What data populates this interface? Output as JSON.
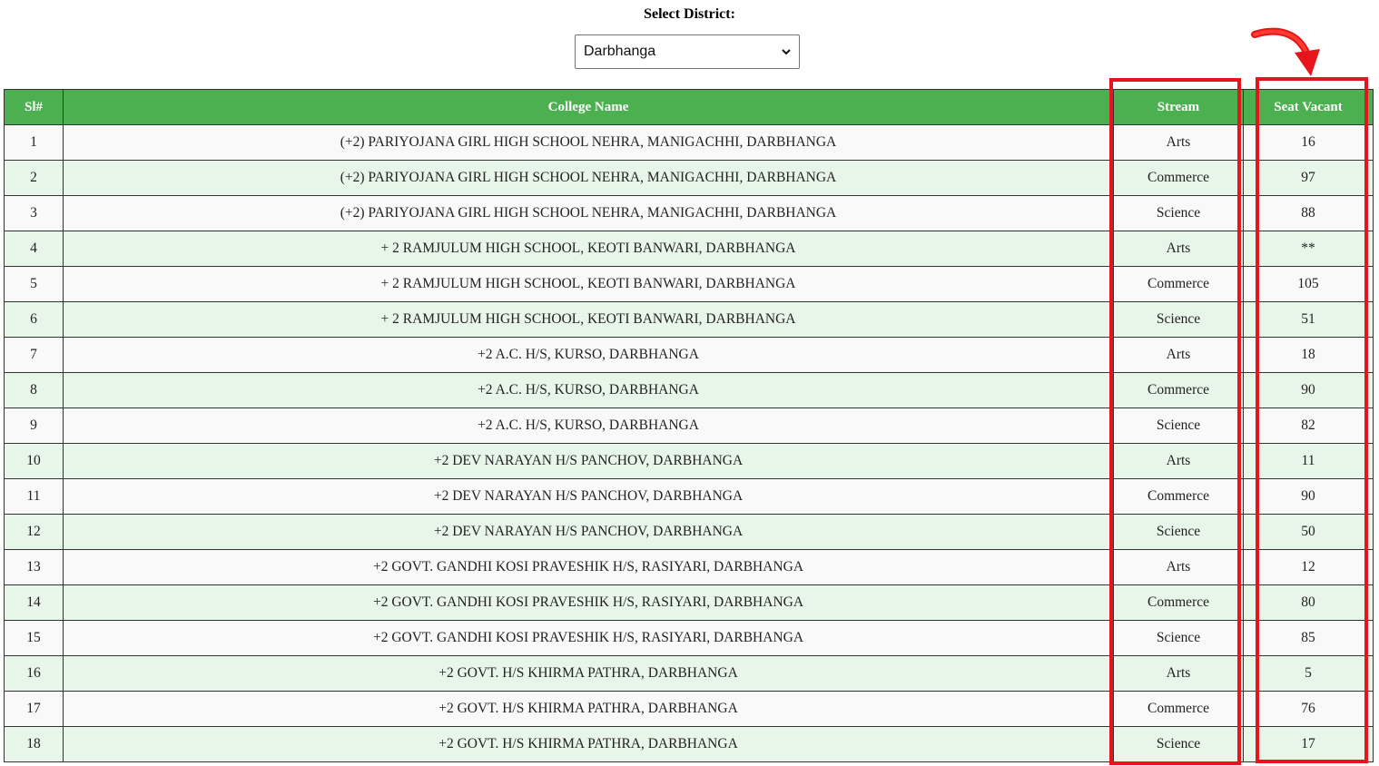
{
  "filter": {
    "label": "Select District:",
    "selected": "Darbhanga"
  },
  "table": {
    "headers": {
      "sl": "Sl#",
      "college": "College Name",
      "stream": "Stream",
      "seats": "Seat Vacant"
    },
    "rows": [
      {
        "sl": "1",
        "college": "(+2) PARIYOJANA GIRL HIGH SCHOOL NEHRA, MANIGACHHI, DARBHANGA",
        "stream": "Arts",
        "seats": "16"
      },
      {
        "sl": "2",
        "college": "(+2) PARIYOJANA GIRL HIGH SCHOOL NEHRA, MANIGACHHI, DARBHANGA",
        "stream": "Commerce",
        "seats": "97"
      },
      {
        "sl": "3",
        "college": "(+2) PARIYOJANA GIRL HIGH SCHOOL NEHRA, MANIGACHHI, DARBHANGA",
        "stream": "Science",
        "seats": "88"
      },
      {
        "sl": "4",
        "college": "+ 2 RAMJULUM HIGH SCHOOL, KEOTI BANWARI, DARBHANGA",
        "stream": "Arts",
        "seats": "**"
      },
      {
        "sl": "5",
        "college": "+ 2 RAMJULUM HIGH SCHOOL, KEOTI BANWARI, DARBHANGA",
        "stream": "Commerce",
        "seats": "105"
      },
      {
        "sl": "6",
        "college": "+ 2 RAMJULUM HIGH SCHOOL, KEOTI BANWARI, DARBHANGA",
        "stream": "Science",
        "seats": "51"
      },
      {
        "sl": "7",
        "college": "+2 A.C. H/S, KURSO, DARBHANGA",
        "stream": "Arts",
        "seats": "18"
      },
      {
        "sl": "8",
        "college": "+2 A.C. H/S, KURSO, DARBHANGA",
        "stream": "Commerce",
        "seats": "90"
      },
      {
        "sl": "9",
        "college": "+2 A.C. H/S, KURSO, DARBHANGA",
        "stream": "Science",
        "seats": "82"
      },
      {
        "sl": "10",
        "college": "+2 DEV NARAYAN H/S PANCHOV, DARBHANGA",
        "stream": "Arts",
        "seats": "11"
      },
      {
        "sl": "11",
        "college": "+2 DEV NARAYAN H/S PANCHOV, DARBHANGA",
        "stream": "Commerce",
        "seats": "90"
      },
      {
        "sl": "12",
        "college": "+2 DEV NARAYAN H/S PANCHOV, DARBHANGA",
        "stream": "Science",
        "seats": "50"
      },
      {
        "sl": "13",
        "college": "+2 GOVT. GANDHI KOSI PRAVESHIK H/S, RASIYARI, DARBHANGA",
        "stream": "Arts",
        "seats": "12"
      },
      {
        "sl": "14",
        "college": "+2 GOVT. GANDHI KOSI PRAVESHIK H/S, RASIYARI, DARBHANGA",
        "stream": "Commerce",
        "seats": "80"
      },
      {
        "sl": "15",
        "college": "+2 GOVT. GANDHI KOSI PRAVESHIK H/S, RASIYARI, DARBHANGA",
        "stream": "Science",
        "seats": "85"
      },
      {
        "sl": "16",
        "college": "+2 GOVT. H/S KHIRMA PATHRA, DARBHANGA",
        "stream": "Arts",
        "seats": "5"
      },
      {
        "sl": "17",
        "college": "+2 GOVT. H/S KHIRMA PATHRA, DARBHANGA",
        "stream": "Commerce",
        "seats": "76"
      },
      {
        "sl": "18",
        "college": "+2 GOVT. H/S KHIRMA PATHRA, DARBHANGA",
        "stream": "Science",
        "seats": "17"
      }
    ]
  },
  "annotation": {
    "highlight_color": "#e8141b",
    "header_color": "#4caf50",
    "arrow_icon": "curved-arrow-icon"
  }
}
